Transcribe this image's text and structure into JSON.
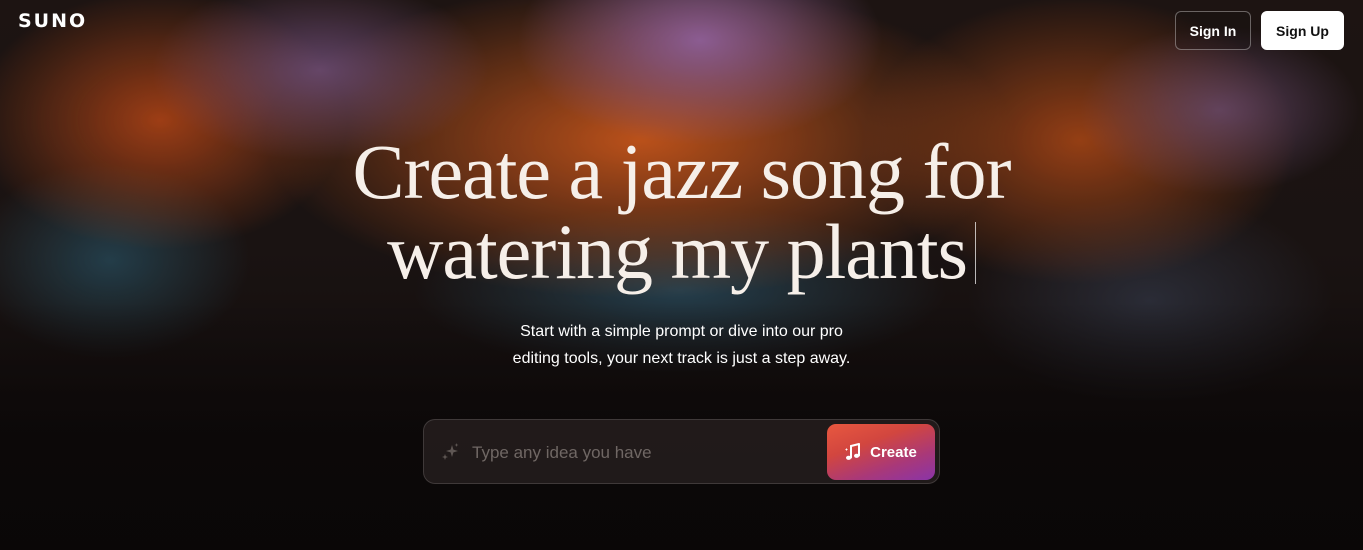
{
  "brand": {
    "logo_text": "SUNO"
  },
  "header": {
    "sign_in_label": "Sign In",
    "sign_up_label": "Sign Up"
  },
  "hero": {
    "headline_line1": "Create a jazz song for",
    "headline_line2": "watering my plants",
    "subtitle_line1": "Start with a simple prompt or dive into our pro",
    "subtitle_line2": "editing tools, your next track is just a step away."
  },
  "prompt": {
    "placeholder": "Type any idea you have",
    "value": "",
    "leading_icon": "sparkle-icon",
    "create_label": "Create",
    "create_icon": "music-note-icon"
  },
  "colors": {
    "accent_gradient_start": "#e8583f",
    "accent_gradient_end": "#8a34a8",
    "background": "#0f0b0b"
  }
}
